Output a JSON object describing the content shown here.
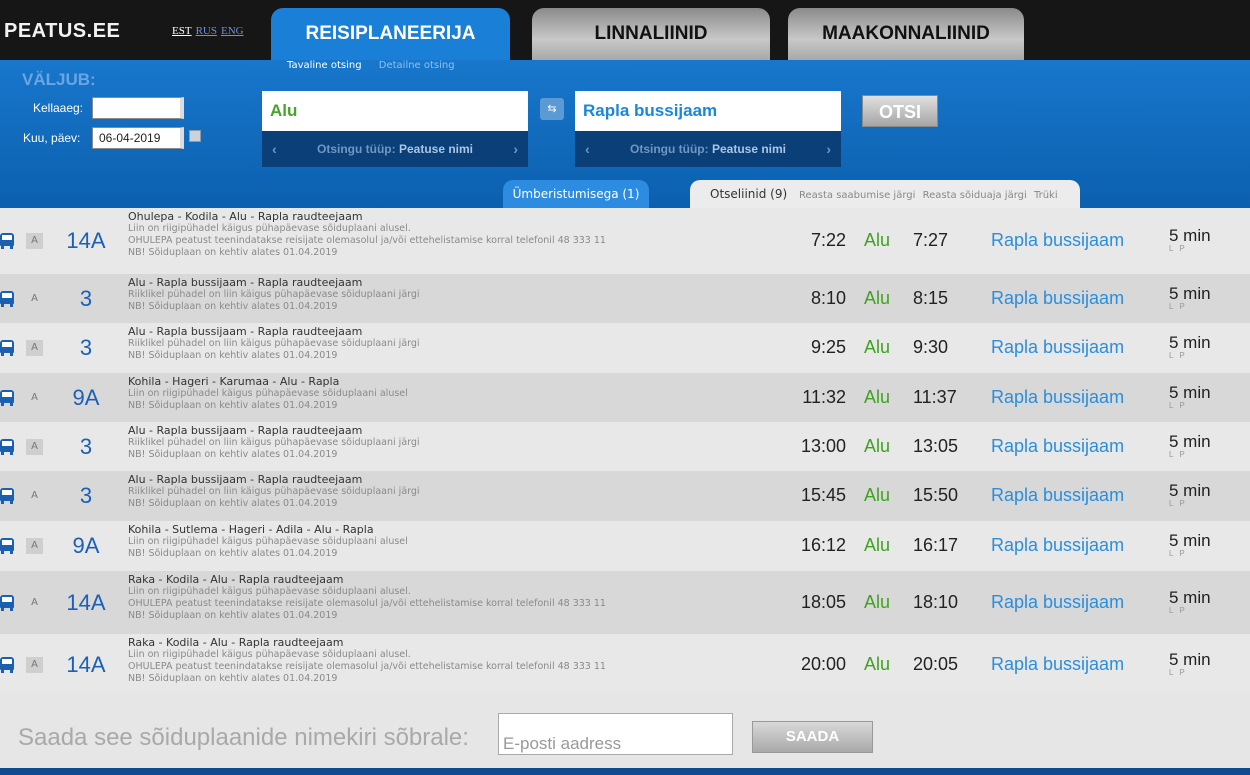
{
  "site": {
    "logo": "PEATUS.EE",
    "languages": [
      {
        "label": "EST",
        "active": true
      },
      {
        "label": "RUS",
        "active": false
      },
      {
        "label": "ENG",
        "active": false
      }
    ]
  },
  "tabs": {
    "planner": "REISIPLANEERIJA",
    "city": "LINNALIINID",
    "county": "MAAKONNALIINID"
  },
  "subtabs": {
    "simple": "Tavaline otsing",
    "detailed": "Detailne otsing"
  },
  "search": {
    "heading": "VÄLJUB:",
    "time_label": "Kellaaeg:",
    "time_value": "",
    "date_label": "Kuu, päev:",
    "date_value": "06-04-2019",
    "from_stop": "Alu",
    "to_stop": "Rapla bussijaam",
    "type_prefix": "Otsingu tüüp:",
    "type_value": "Peatuse nimi",
    "search_button": "OTSI"
  },
  "result_tabs": {
    "transfers": "Ümberistumisega (1)",
    "direct": "Otseliinid (9)",
    "sort_arrival": "Reasta saabumise järgi",
    "sort_duration": "Reasta sõiduaja järgi",
    "print": "Trüki"
  },
  "results": [
    {
      "route": "14A",
      "name": "Ohulepa - Kodila - Alu - Rapla raudteejaam",
      "notes": [
        "Liin on riigipühadel käigus pühapäevase sõiduplaani alusel.",
        "OHULEPA peatust teenindatakse reisijate olemasolul ja/või ettehelistamise korral telefonil 48 333 11",
        "NB! Sõiduplaan on kehtiv alates 01.04.2019"
      ],
      "dep": "7:22",
      "stop": "Alu",
      "arr": "7:27",
      "dest": "Rapla bussijaam",
      "dur": "5 min",
      "lp": "L P"
    },
    {
      "route": "3",
      "name": "Alu - Rapla bussijaam - Rapla raudteejaam",
      "notes": [
        "Riiklikel pühadel on liin käigus pühapäevase sõiduplaani järgi",
        "NB! Sõiduplaan on kehtiv alates 01.04.2019"
      ],
      "dep": "8:10",
      "stop": "Alu",
      "arr": "8:15",
      "dest": "Rapla bussijaam",
      "dur": "5 min",
      "lp": "L P"
    },
    {
      "route": "3",
      "name": "Alu - Rapla bussijaam - Rapla raudteejaam",
      "notes": [
        "Riiklikel pühadel on liin käigus pühapäevase sõiduplaani järgi",
        "NB! Sõiduplaan on kehtiv alates 01.04.2019"
      ],
      "dep": "9:25",
      "stop": "Alu",
      "arr": "9:30",
      "dest": "Rapla bussijaam",
      "dur": "5 min",
      "lp": "L P"
    },
    {
      "route": "9A",
      "name": "Kohila - Hageri - Karumaa - Alu - Rapla",
      "notes": [
        "Liin on riigipühadel käigus pühapäevase sõiduplaani alusel",
        "NB! Sõiduplaan on kehtiv alates 01.04.2019"
      ],
      "dep": "11:32",
      "stop": "Alu",
      "arr": "11:37",
      "dest": "Rapla bussijaam",
      "dur": "5 min",
      "lp": "L P"
    },
    {
      "route": "3",
      "name": "Alu - Rapla bussijaam - Rapla raudteejaam",
      "notes": [
        "Riiklikel pühadel on liin käigus pühapäevase sõiduplaani järgi",
        "NB! Sõiduplaan on kehtiv alates 01.04.2019"
      ],
      "dep": "13:00",
      "stop": "Alu",
      "arr": "13:05",
      "dest": "Rapla bussijaam",
      "dur": "5 min",
      "lp": "L P"
    },
    {
      "route": "3",
      "name": "Alu - Rapla bussijaam - Rapla raudteejaam",
      "notes": [
        "Riiklikel pühadel on liin käigus pühapäevase sõiduplaani järgi",
        "NB! Sõiduplaan on kehtiv alates 01.04.2019"
      ],
      "dep": "15:45",
      "stop": "Alu",
      "arr": "15:50",
      "dest": "Rapla bussijaam",
      "dur": "5 min",
      "lp": "L P"
    },
    {
      "route": "9A",
      "name": "Kohila - Sutlema - Hageri - Adila - Alu - Rapla",
      "notes": [
        "Liin on riigipühadel käigus pühapäevase sõiduplaani alusel",
        "NB! Sõiduplaan on kehtiv alates 01.04.2019"
      ],
      "dep": "16:12",
      "stop": "Alu",
      "arr": "16:17",
      "dest": "Rapla bussijaam",
      "dur": "5 min",
      "lp": "L P"
    },
    {
      "route": "14A",
      "name": "Raka - Kodila - Alu - Rapla raudteejaam",
      "notes": [
        "Liin on riigipühadel käigus pühapäevase sõiduplaani alusel.",
        "OHULEPA peatust teenindatakse reisijate olemasolul ja/või ettehelistamise korral telefonil 48 333 11",
        "NB! Sõiduplaan on kehtiv alates 01.04.2019"
      ],
      "dep": "18:05",
      "stop": "Alu",
      "arr": "18:10",
      "dest": "Rapla bussijaam",
      "dur": "5 min",
      "lp": "L P"
    },
    {
      "route": "14A",
      "name": "Raka - Kodila - Alu - Rapla raudteejaam",
      "notes": [
        "Liin on riigipühadel käigus pühapäevase sõiduplaani alusel.",
        "OHULEPA peatust teenindatakse reisijate olemasolul ja/või ettehelistamise korral telefonil 48 333 11",
        "NB! Sõiduplaan on kehtiv alates 01.04.2019"
      ],
      "dep": "20:00",
      "stop": "Alu",
      "arr": "20:05",
      "dest": "Rapla bussijaam",
      "dur": "5 min",
      "lp": "L P"
    }
  ],
  "row_badge": "A",
  "footer": {
    "send_label": "Saada see sõiduplaanide nimekiri sõbrale:",
    "email_placeholder": "E-posti aadress",
    "send_button": "SAADA"
  },
  "colors": {
    "brand_blue": "#1a7fd6",
    "stop_green": "#3ea31f",
    "dest_blue": "#2a8edc"
  }
}
